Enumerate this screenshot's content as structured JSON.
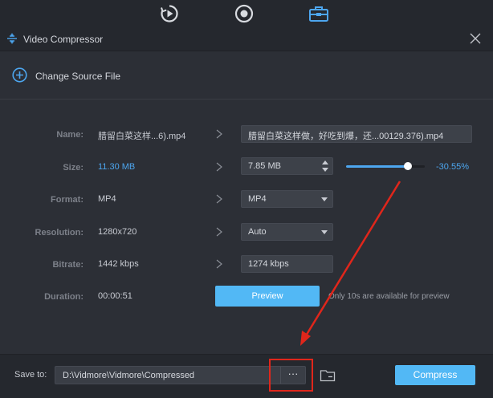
{
  "app": {
    "title": "Video Compressor"
  },
  "topbar": {
    "icons": [
      "rotate-play-icon",
      "disc-icon",
      "toolbox-icon"
    ],
    "active_color": "#4da6ef"
  },
  "source": {
    "label": "Change Source File"
  },
  "rows": {
    "name": {
      "label": "Name:",
      "original": "腊留白菜这样...6).mp4",
      "output": "腊留白菜这样做，好吃到爆，还...00129.376).mp4"
    },
    "size": {
      "label": "Size:",
      "original": "11.30 MB",
      "output": "7.85 MB",
      "percent": "-30.55%",
      "slider_fraction": 0.79
    },
    "format": {
      "label": "Format:",
      "original": "MP4",
      "output": "MP4"
    },
    "resolution": {
      "label": "Resolution:",
      "original": "1280x720",
      "output": "Auto"
    },
    "bitrate": {
      "label": "Bitrate:",
      "original": "1442 kbps",
      "output": "1274 kbps"
    },
    "duration": {
      "label": "Duration:",
      "original": "00:00:51"
    }
  },
  "preview": {
    "button": "Preview",
    "note": "Only 10s are available for preview"
  },
  "bottom": {
    "save_label": "Save to:",
    "path": "D:\\Vidmore\\Vidmore\\Compressed",
    "browse": "···",
    "compress": "Compress"
  },
  "colors": {
    "accent": "#52b8f5",
    "highlight": "#4da6ef",
    "annotation": "#e0261b"
  }
}
